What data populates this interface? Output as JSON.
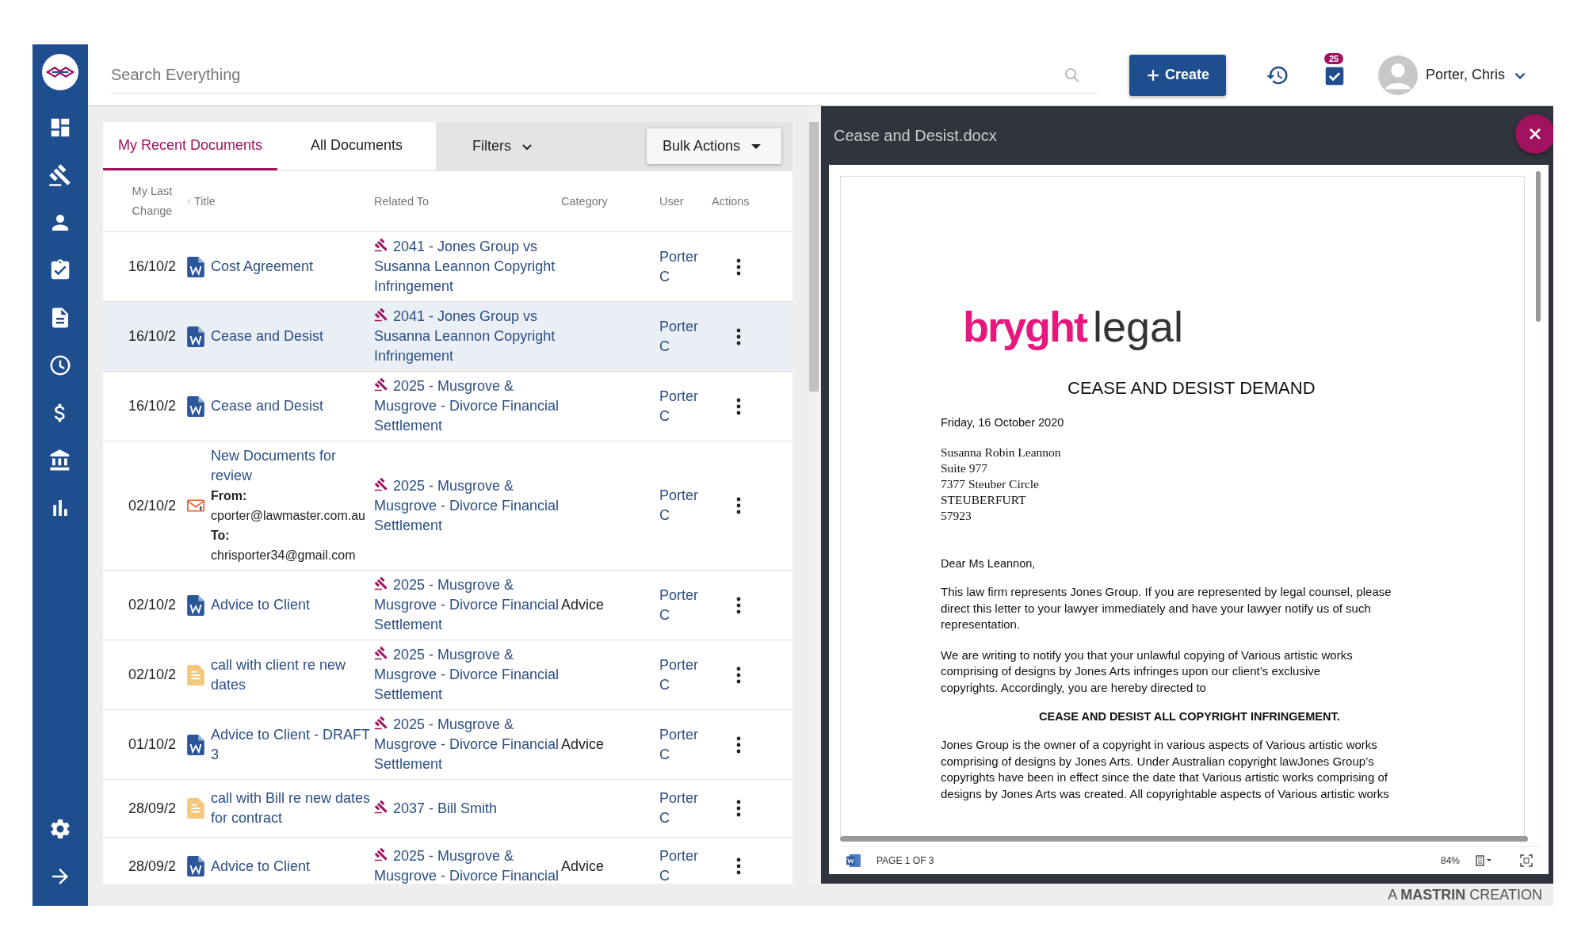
{
  "search": {
    "placeholder": "Search Everything"
  },
  "create_button": {
    "label": "Create"
  },
  "tasks_badge": "25",
  "user": {
    "name": "Porter, Chris"
  },
  "tabs": [
    {
      "label": "My Recent Documents",
      "selected": true
    },
    {
      "label": "All Documents",
      "selected": false
    }
  ],
  "filters": "Filters",
  "bulk_actions": "Bulk Actions",
  "columns": [
    "My Last Change",
    "Title",
    "Related To",
    "Category",
    "User",
    "Actions"
  ],
  "rows": [
    {
      "date": "16/10/2",
      "kind": "document",
      "title": "Cost Agreement",
      "related": "2041 - Jones Group vs Susanna Leannon Copyright Infringement",
      "user": "Porter C",
      "selected": false
    },
    {
      "date": "16/10/2",
      "kind": "document",
      "title": "Cease and Desist",
      "related": "2041 - Jones Group vs Susanna Leannon Copyright Infringement",
      "user": "Porter C",
      "selected": true
    },
    {
      "date": "16/10/2",
      "kind": "document",
      "title": "Cease and Desist",
      "related": "2025 - Musgrove & Musgrove - Divorce Financial Settlement",
      "user": "Porter C",
      "selected": false
    },
    {
      "date": "02/10/2",
      "kind": "email",
      "title": "New Documents for review",
      "from_label": "From:",
      "from": "cporter@lawmaster.com.au",
      "to_label": "To:",
      "to": "chrisporter34@gmail.com",
      "related": "2025 - Musgrove & Musgrove - Divorce Financial Settlement",
      "user": "Porter C",
      "selected": false
    },
    {
      "date": "02/10/2",
      "kind": "document",
      "title": "Advice to Client",
      "related": "2025 - Musgrove & Musgrove - Divorce Financial Settlement",
      "category": "Advice",
      "user": "Porter C",
      "selected": false
    },
    {
      "date": "02/10/2",
      "kind": "note",
      "title": "call with client re new dates",
      "related": "2025 - Musgrove & Musgrove - Divorce Financial Settlement",
      "user": "Porter C",
      "selected": false
    },
    {
      "date": "01/10/2",
      "kind": "document",
      "title": "Advice to Client - DRAFT 3",
      "related": "2025 - Musgrove & Musgrove - Divorce Financial Settlement",
      "category": "Advice",
      "user": "Porter C",
      "selected": false
    },
    {
      "date": "28/09/2",
      "kind": "note",
      "title": "call with Bill re new dates for contract",
      "related": "2037 - Bill Smith",
      "user": "Porter C",
      "selected": false
    },
    {
      "date": "28/09/2",
      "kind": "document",
      "title": "Advice to Client",
      "related": "2025 - Musgrove & Musgrove - Divorce Financial",
      "category": "Advice",
      "user": "Porter C",
      "selected": false
    }
  ],
  "preview": {
    "title": "Cease and Desist.docx",
    "document": {
      "logo": [
        "bryght",
        "legal"
      ],
      "heading": "CEASE AND DESIST DEMAND",
      "date": "Friday, 16 October 2020",
      "address": [
        "Susanna Robin Leannon",
        "Suite 977",
        "7377 Steuber Circle",
        "STEUBERFURT",
        "57923"
      ],
      "salutation": "Dear Ms Leannon,",
      "paragraphs": [
        [
          "This law firm represents Jones Group. If you are represented by legal counsel, please",
          "direct this letter to your lawyer immediately and have your lawyer notify us of such",
          "representation."
        ],
        [
          "We are writing to notify you that your unlawful copying of Various artistic works",
          "comprising of designs by Jones Arts  infringes upon our client’s exclusive",
          "copyrights.  Accordingly, you are hereby directed to"
        ]
      ],
      "demand": "CEASE AND DESIST ALL COPYRIGHT INFRINGEMENT.",
      "closing": [
        "Jones Group  is the owner of a copyright in various aspects of Various artistic works",
        "comprising of designs by Jones Arts.  Under Australian copyright lawJones Group’s",
        "copyrights have been in effect since the date that Various artistic works comprising of",
        "designs by Jones Arts  was created.  All copyrightable aspects of Various artistic works"
      ]
    },
    "page_indicator": "PAGE 1 OF 3",
    "zoom": "84%"
  },
  "footer": "A **MASTRIN** CREATION"
}
